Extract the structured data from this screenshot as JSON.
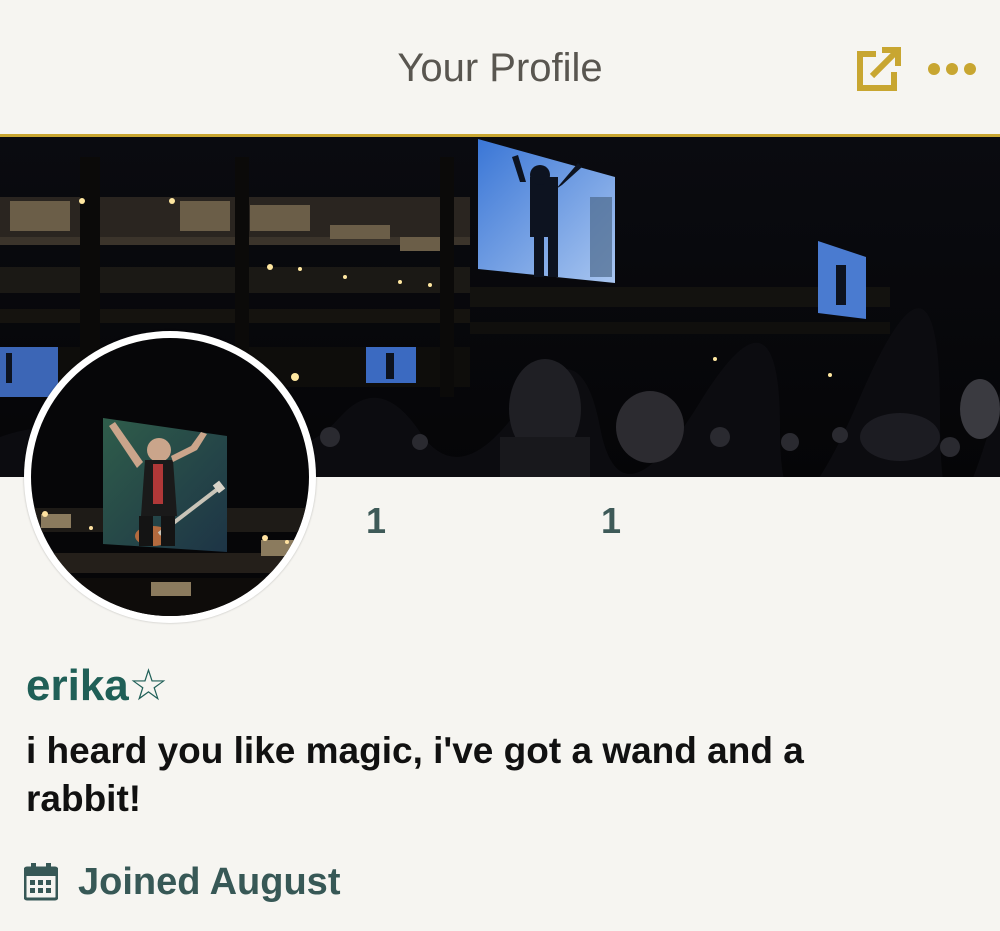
{
  "header": {
    "title": "Your Profile",
    "share_icon": "external-link-icon",
    "more_icon": "more-horizontal-icon",
    "accent_color": "#c8a631"
  },
  "cover": {
    "image": "concert-crowd-cover-photo"
  },
  "avatar": {
    "image": "performer-on-stage-screen-photo"
  },
  "stats": [
    {
      "value": "1"
    },
    {
      "value": "1"
    }
  ],
  "profile": {
    "username": "erika☆",
    "bio": "i heard you like magic, i've got a wand and a rabbit!",
    "joined_icon": "calendar-icon",
    "joined": "Joined August"
  },
  "colors": {
    "background": "#f6f5f1",
    "title_text": "#595650",
    "username": "#1f5f57",
    "joined_text": "#375856"
  }
}
